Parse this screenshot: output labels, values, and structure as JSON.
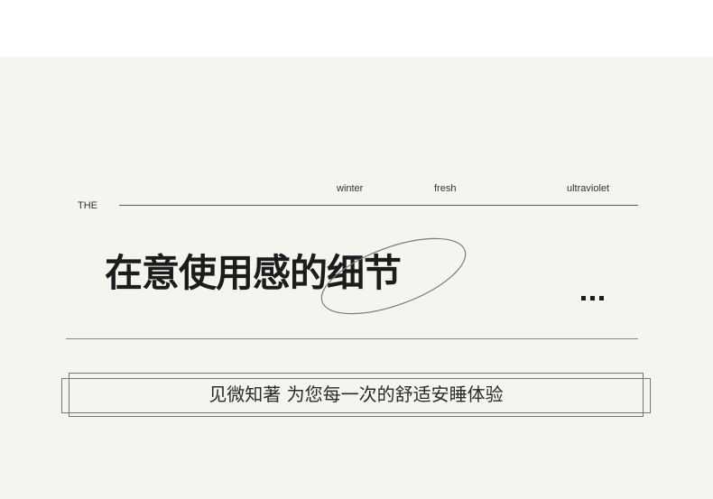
{
  "labels": {
    "the": "THE",
    "winter": "winter",
    "fresh": "fresh",
    "ultraviolet": "ultraviolet"
  },
  "headline": "在意使用感的细节",
  "tagline": "见微知著 为您每一次的舒适安睡体验",
  "colors": {
    "panel_background": "#f5f4ef",
    "text_dark": "#1c1c1c",
    "line_gray": "#777777"
  }
}
